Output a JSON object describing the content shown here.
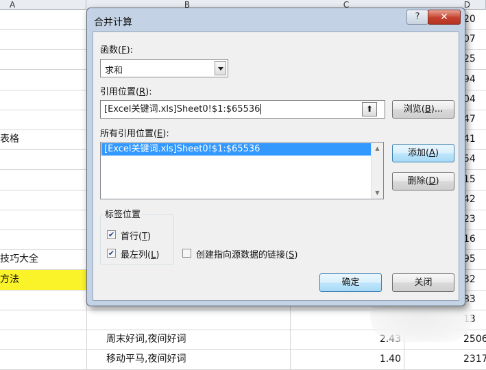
{
  "sheet": {
    "columns": [
      "A",
      "B",
      "C",
      "D"
    ],
    "rows": [
      {
        "a": "",
        "b": "",
        "c": "",
        "d": "20"
      },
      {
        "a": "",
        "b": "",
        "c": "",
        "d": "07"
      },
      {
        "a": "",
        "b": "",
        "c": "",
        "d": "25"
      },
      {
        "a": "",
        "b": "",
        "c": "",
        "d": "94"
      },
      {
        "a": "",
        "b": "",
        "c": "",
        "d": "04"
      },
      {
        "a": "",
        "b": "",
        "c": "",
        "d": "47"
      },
      {
        "a": "表格",
        "b": "",
        "c": "",
        "d": "41"
      },
      {
        "a": "",
        "b": "",
        "c": "",
        "d": "54"
      },
      {
        "a": "",
        "b": "",
        "c": "",
        "d": "15"
      },
      {
        "a": "",
        "b": "",
        "c": "",
        "d": "42"
      },
      {
        "a": "",
        "b": "",
        "c": "",
        "d": "23"
      },
      {
        "a": "",
        "b": "",
        "c": "",
        "d": "16"
      },
      {
        "a": "技巧大全",
        "b": "",
        "c": "",
        "d": "95"
      },
      {
        "a": "方法",
        "b": "",
        "c": "",
        "d": "32",
        "highlight": true
      },
      {
        "a": "",
        "b": "",
        "c": "",
        "d": "83"
      },
      {
        "a": "",
        "b": "",
        "c": "",
        "d": "13"
      },
      {
        "a": "",
        "b": "周末好词,夜间好词",
        "c": "2.43",
        "d": "2506"
      },
      {
        "a": "",
        "b": "移动平马,夜间好词",
        "c": "1.40",
        "d": "2317"
      }
    ]
  },
  "dialog": {
    "title": "合并计算",
    "help_label": "?",
    "close_label": "✕",
    "function": {
      "label_text": "函数(",
      "label_key": "F",
      "label_end": "):",
      "value": "求和"
    },
    "reference": {
      "label_text": "引用位置(",
      "label_key": "R",
      "label_end": "):",
      "value": "[Excel关键词.xls]Sheet0!$1:$65536",
      "collapse_symbol": "⬆"
    },
    "browse_button": {
      "text": "浏览(",
      "key": "B",
      "end": ")..."
    },
    "all_refs": {
      "label_text": "所有引用位置(",
      "label_key": "E",
      "label_end": "):",
      "items": [
        "[Excel关键词.xls]Sheet0!$1:$65536"
      ]
    },
    "add_button": {
      "text": "添加(",
      "key": "A",
      "end": ")"
    },
    "delete_button": {
      "text": "删除(",
      "key": "D",
      "end": ")"
    },
    "labels_group": {
      "title": "标签位置",
      "first_row": {
        "text": "首行(",
        "key": "T",
        "end": ")",
        "checked": true
      },
      "left_column": {
        "text": "最左列(",
        "key": "L",
        "end": ")",
        "checked": true
      }
    },
    "link_source": {
      "text": "创建指向源数据的链接(",
      "key": "S",
      "end": ")",
      "checked": false
    },
    "ok_button": "确定",
    "close_button": "关闭"
  }
}
